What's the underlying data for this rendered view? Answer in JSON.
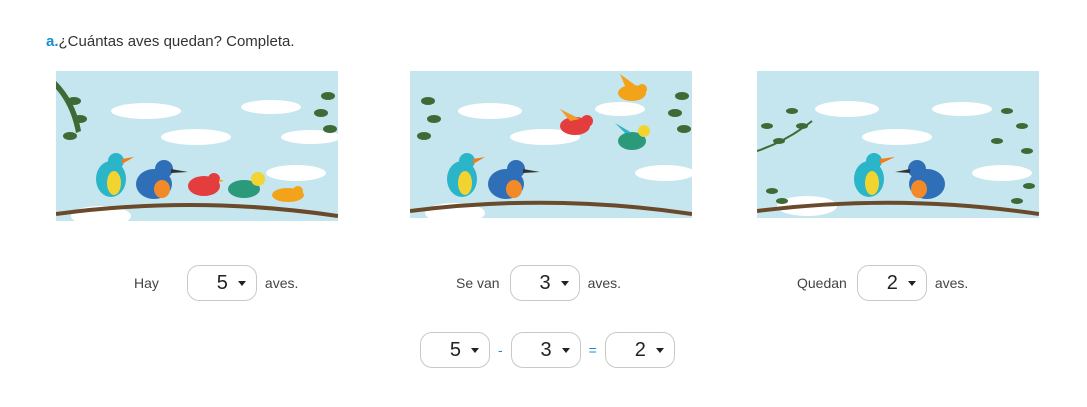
{
  "question": {
    "letter": "a.",
    "text": "¿Cuántas aves quedan? Completa."
  },
  "scenes": [
    {
      "label": "Hay",
      "value": "5",
      "suffix": "aves."
    },
    {
      "label": "Se van",
      "value": "3",
      "suffix": "aves."
    },
    {
      "label": "Quedan",
      "value": "2",
      "suffix": "aves."
    }
  ],
  "equation": {
    "a": "5",
    "op1": "-",
    "b": "3",
    "op2": "=",
    "c": "2"
  },
  "colors": {
    "sky": "#c5e6ee",
    "accent": "#1a8fd0",
    "branch": "#6b4a2c",
    "leaf": "#3e6b35"
  }
}
